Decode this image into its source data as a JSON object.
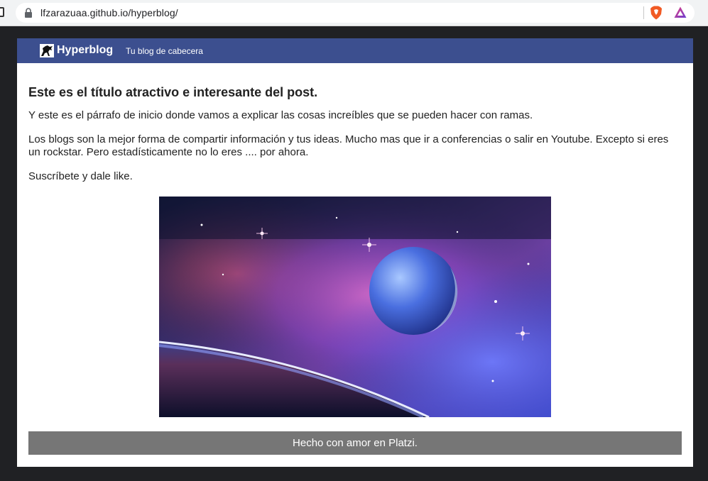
{
  "browser": {
    "url": "lfzarazuaa.github.io/hyperblog/",
    "lock_icon": "lock-icon",
    "extensions": [
      "brave-shield-icon",
      "brave-rewards-icon"
    ]
  },
  "site": {
    "title": "Hyperblog",
    "tagline": "Tu blog de cabecera",
    "header_color": "#3c4f8f",
    "logo_icon": "horse-icon"
  },
  "post": {
    "title": "Este es el título atractivo e interesante del post.",
    "paragraphs": [
      "Y este es el párrafo de inicio donde vamos a explicar las cosas increíbles que se pueden hacer con ramas.",
      "Los blogs son la mejor forma de compartir información y tus ideas. Mucho mas que ir a conferencias o salir en Youtube. Excepto si eres un rockstar. Pero estadísticamente no lo eres .... por ahora.",
      "Suscríbete y dale like."
    ],
    "image_subject": "space-planet-nebula-image"
  },
  "footer": {
    "text": "Hecho con amor en Platzi.",
    "color": "#767676"
  }
}
